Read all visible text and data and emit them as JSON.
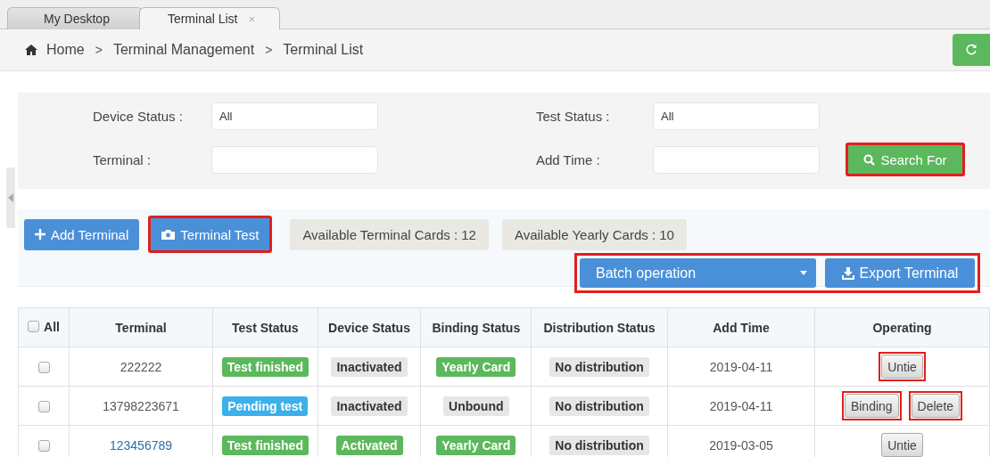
{
  "tabs": [
    {
      "label": "My Desktop",
      "selected": false
    },
    {
      "label": "Terminal List",
      "selected": true,
      "close": "×"
    }
  ],
  "breadcrumb": {
    "items": [
      "Home",
      "Terminal Management",
      "Terminal List"
    ],
    "separator": ">"
  },
  "filters": [
    {
      "label": "Device Status :",
      "value": "All"
    },
    {
      "label": "Test Status :",
      "value": "All"
    },
    {
      "label": "Terminal :"
    },
    {
      "label": "Add Time :"
    }
  ],
  "search_button": {
    "label": "Search For",
    "highlighted": true
  },
  "toolbar": {
    "add_button": {
      "label": "Add Terminal",
      "highlighted": false
    },
    "test_button": {
      "label": "Terminal Test",
      "highlighted": true
    },
    "cards": [
      "Available Terminal Cards : 12",
      "Available Yearly Cards : 10"
    ],
    "batch_select": {
      "value": "Batch operation"
    },
    "export_button": {
      "label": "Export Terminal"
    },
    "batch_group_highlighted": true
  },
  "table": {
    "select_all": {
      "label": "All",
      "checked": false
    },
    "columns": [
      "Terminal",
      "Test Status",
      "Device Status",
      "Binding Status",
      "Distribution Status",
      "Add Time",
      "Operating"
    ],
    "rows": [
      {
        "checked": false,
        "terminal": {
          "text": "222222",
          "kind": "plain"
        },
        "test_status": {
          "text": "Test finished",
          "kind": "success"
        },
        "device_status": {
          "text": "Inactivated",
          "kind": "default"
        },
        "binding_status": {
          "text": "Yearly Card",
          "kind": "success"
        },
        "distribution_status": {
          "text": "No distribution",
          "kind": "default"
        },
        "add_time": "2019-04-11",
        "actions": [
          {
            "label": "Untie",
            "highlighted": true
          }
        ]
      },
      {
        "checked": false,
        "terminal": {
          "text": "13798223671",
          "kind": "plain"
        },
        "test_status": {
          "text": "Pending test",
          "kind": "info"
        },
        "device_status": {
          "text": "Inactivated",
          "kind": "default"
        },
        "binding_status": {
          "text": "Unbound",
          "kind": "default"
        },
        "distribution_status": {
          "text": "No distribution",
          "kind": "default"
        },
        "add_time": "2019-04-11",
        "actions": [
          {
            "label": "Binding",
            "highlighted": true
          },
          {
            "label": "Delete",
            "highlighted": true
          }
        ]
      },
      {
        "checked": false,
        "terminal": {
          "text": "123456789",
          "kind": "link"
        },
        "test_status": {
          "text": "Test finished",
          "kind": "success"
        },
        "device_status": {
          "text": "Activated",
          "kind": "success"
        },
        "binding_status": {
          "text": "Yearly Card",
          "kind": "success"
        },
        "distribution_status": {
          "text": "No distribution",
          "kind": "default"
        },
        "add_time": "2019-03-05",
        "actions": [
          {
            "label": "Untie",
            "highlighted": false
          }
        ]
      }
    ]
  }
}
